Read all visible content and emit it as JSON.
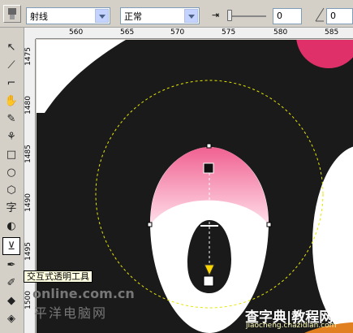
{
  "propbar": {
    "transparency_type": "射线",
    "merge_mode": "正常",
    "midpoint_value": "0",
    "right_value": "0"
  },
  "ruler_top": [
    "560",
    "565",
    "570",
    "575",
    "580",
    "585"
  ],
  "ruler_left": [
    "1475",
    "1480",
    "1485",
    "1490",
    "1495",
    "1500"
  ],
  "tooltip": "交互式透明工具",
  "watermark": {
    "site1": "online.com.cn",
    "site1_cn": "平洋电脑网",
    "site2": "查字典",
    "site2_b": "教程网",
    "site2_url": "jiaocheng.chazidian.com"
  },
  "tools": [
    "pick-tool",
    "shape-tool",
    "crop-tool",
    "zoom-tool",
    "freehand-tool",
    "smart-fill-tool",
    "rectangle-tool",
    "ellipse-tool",
    "polygon-tool",
    "text-tool",
    "interactive-fill-tool",
    "transparency-tool",
    "eyedropper-tool",
    "outline-tool",
    "fill-tool"
  ]
}
